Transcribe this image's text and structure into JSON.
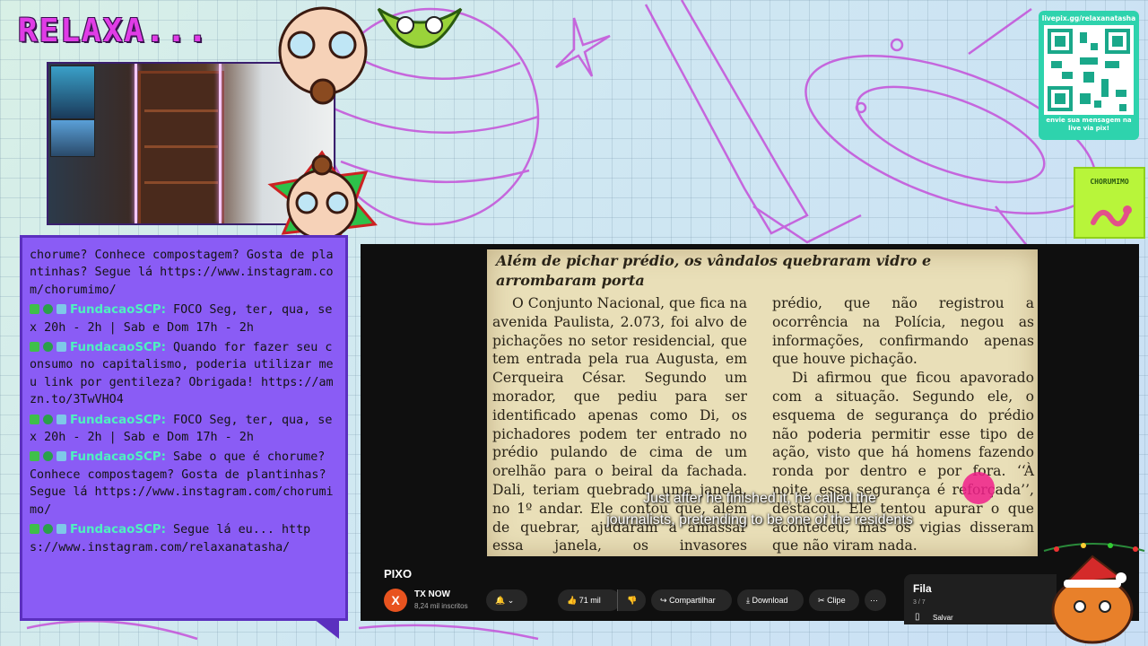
{
  "overlay": {
    "logo_text": "RELAXA...",
    "qr": {
      "url_text": "livepix.gg/relaxanatasha",
      "message": "envie sua mensagem na live via pix!"
    },
    "sticker_text": "CHORUMIMO"
  },
  "chat": {
    "messages": [
      {
        "user": "",
        "text": "chorume? Conhece compostagem? Gosta de plantinhas? Segue lá https://www.instagram.com/chorumimo/"
      },
      {
        "user": "FundacaoSCP:",
        "text": "FOCO Seg, ter, qua, sex 20h - 2h | Sab e Dom 17h - 2h"
      },
      {
        "user": "FundacaoSCP:",
        "text": "Quando for fazer seu consumo no capitalismo, poderia utilizar meu link por gentileza? Obrigada! https://amzn.to/3TwVHO4"
      },
      {
        "user": "FundacaoSCP:",
        "text": "FOCO Seg, ter, qua, sex 20h - 2h | Sab e Dom 17h - 2h"
      },
      {
        "user": "FundacaoSCP:",
        "text": "Sabe o que é chorume? Conhece compostagem? Gosta de plantinhas? Segue lá https://www.instagram.com/chorumimo/"
      },
      {
        "user": "FundacaoSCP:",
        "text": "Segue lá eu... https://www.instagram.com/relaxanatasha/"
      }
    ],
    "badge_colors": [
      "#3fbf4a",
      "#2aa04a",
      "#7ec8e8"
    ]
  },
  "video": {
    "clipping": {
      "headline": "Além de pichar prédio, os vândalos quebraram vidro e arrombaram porta",
      "col1": "O Conjunto Nacional, que fica na avenida Paulista, 2.073, foi alvo de pichações no setor residencial, que tem entrada pela rua Augusta, em Cerqueira César. Segundo um morador, que pediu para ser identificado apenas como Di, os pichadores podem ter entrado no prédio pulando de cima de um orelhão para o beiral da fachada. Dali, teriam quebrado uma janela, no 1º andar. Ele contou que, além de quebrar, ajudaram a amassar essa janela, os invasores arrombaram portas. A administração do",
      "col2a": "prédio, que não registrou a ocorrência na Polícia, negou as informações, confirmando apenas que houve pichação.",
      "col2b": "Di afirmou que ficou apavorado com a situação. Segundo ele, o esquema de segurança do prédio não poderia permitir esse tipo de ação, visto que há homens fazendo ronda por dentro e por fora. ‘‘À noite, essa segurança é reforçada’’, destacou. Ele tentou apurar o que aconteceu, mas os vigias disseram que não viram nada."
    },
    "subtitle_line1": "Just after he finished it, he called the",
    "subtitle_line2": "journalists, pretending to be one of the residents",
    "title": "PIXO",
    "channel": {
      "avatar_letter": "X",
      "name": "TX NOW",
      "subscribers": "8,24 mil inscritos"
    },
    "actions": {
      "likes": "71 mil",
      "share": "Compartilhar",
      "download": "Download",
      "clip": "Clipe",
      "more": "⋯"
    },
    "queue": {
      "label": "Fila",
      "position": "3 / 7",
      "save": "Salvar"
    }
  },
  "colors": {
    "accent": "#e03ce6",
    "chat_bg": "#8a5cf5",
    "username": "#4ff0c0",
    "qr_bg": "#2ed3ad"
  }
}
